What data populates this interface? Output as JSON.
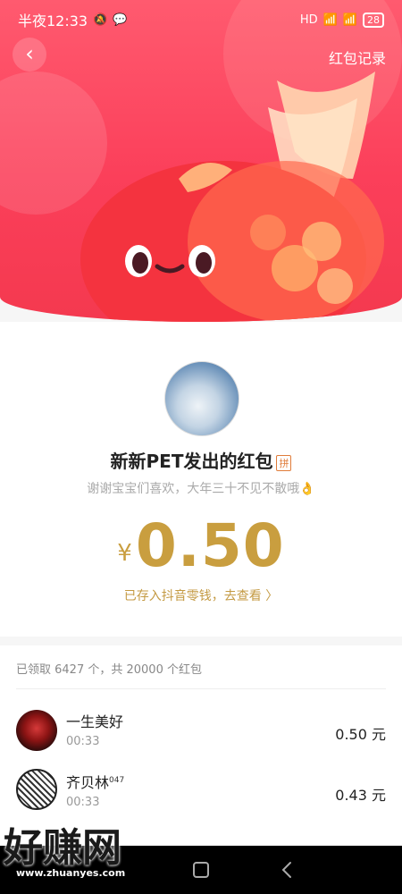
{
  "status_bar": {
    "time": "半夜12:33",
    "network": "HD",
    "battery": "28"
  },
  "header": {
    "back_icon": "chevron-left-icon",
    "record_link": "红包记录"
  },
  "envelope": {
    "sender": "新新PET发出的红包",
    "pin_badge": "拼",
    "blessing": "谢谢宝宝们喜欢，大年三十不见不散哦👌",
    "currency": "¥",
    "amount": "0.50",
    "stored_hint": "已存入抖音零钱，去查看 〉",
    "accent_color": "#c99e3f"
  },
  "claims": {
    "summary": "已领取 6427 个，共 20000 个红包",
    "items": [
      {
        "name": "一生美好",
        "time": "00:33",
        "amount": "0.50 元"
      },
      {
        "name": "齐贝林",
        "superscript": "047",
        "time": "00:33",
        "amount": "0.43 元"
      }
    ]
  },
  "watermark": {
    "text": "好赚网",
    "url": "www.zhuanyes.com"
  }
}
